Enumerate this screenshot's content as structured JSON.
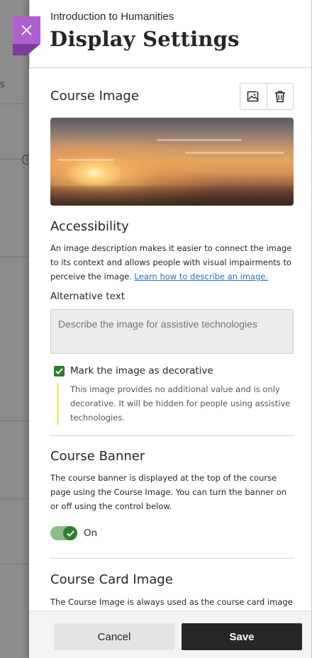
{
  "background": {
    "partial_label": "s"
  },
  "header": {
    "course_name": "Introduction to Humanities",
    "title": "Display Settings",
    "close_icon": "close-x-icon"
  },
  "course_image": {
    "heading": "Course Image",
    "buttons": [
      {
        "icon": "image-edit-icon"
      },
      {
        "icon": "trash-icon"
      }
    ]
  },
  "accessibility": {
    "heading": "Accessibility",
    "description": "An image description makes it easier to connect the image to its context and allows people with visual impairments to perceive the image.",
    "link_text": "Learn how to describe an image.",
    "alt_text_label": "Alternative text",
    "alt_text_placeholder": "Describe the image for assistive technologies",
    "alt_text_value": "",
    "decorative_checkbox": {
      "label": "Mark the image as decorative",
      "checked": true
    },
    "decorative_note": "This image provides no additional value and is only decorative. It will be hidden for people using assistive technologies."
  },
  "course_banner": {
    "heading": "Course Banner",
    "description": "The course banner is displayed at the top of the course page using the Course Image. You can turn the banner on or off using the control below.",
    "toggle": {
      "label": "On",
      "on": true
    }
  },
  "course_card_image": {
    "heading": "Course Card Image",
    "description": "The Course Image is always used as the course card image"
  },
  "footer": {
    "cancel_label": "Cancel",
    "save_label": "Save"
  },
  "colors": {
    "accent_purple": "#b05fd1",
    "check_green": "#2f7d32",
    "toggle_track": "#8fbd8a",
    "link_blue": "#2a6ebb",
    "save_bg": "#262626",
    "note_border": "#f4e88a"
  }
}
